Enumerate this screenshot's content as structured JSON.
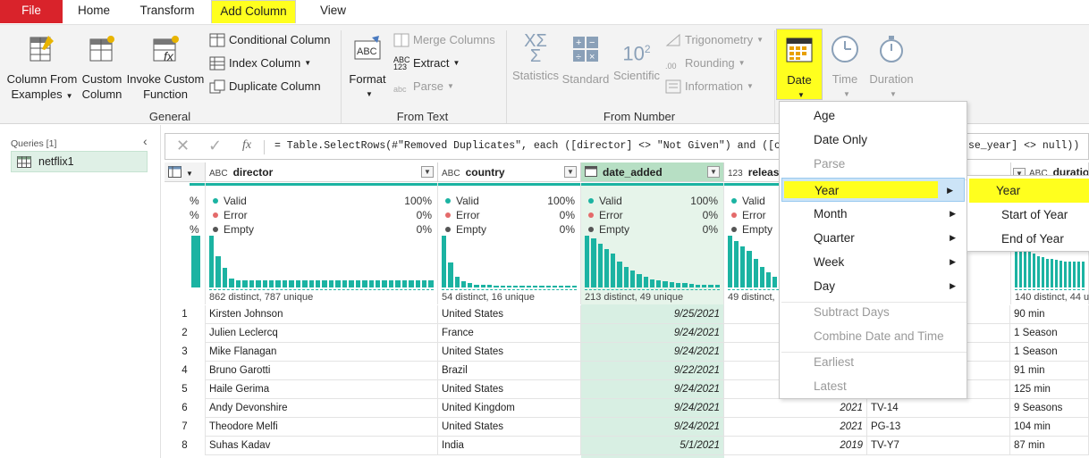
{
  "tabs": [
    "File",
    "Home",
    "Transform",
    "Add Column",
    "View"
  ],
  "ribbon": {
    "general": {
      "label": "General",
      "col_from_examples": [
        "Column From",
        "Examples"
      ],
      "custom_column": [
        "Custom",
        "Column"
      ],
      "invoke_custom_function": [
        "Invoke Custom",
        "Function"
      ],
      "conditional_column": "Conditional Column",
      "index_column": "Index Column",
      "duplicate_column": "Duplicate Column"
    },
    "from_text": {
      "label": "From Text",
      "format": "Format",
      "merge_columns": "Merge Columns",
      "extract": "Extract",
      "parse": "Parse",
      "extract_icon_text": [
        "ABC",
        "123"
      ],
      "parse_icon_text": "abc"
    },
    "from_number": {
      "label": "From Number",
      "statistics": "Statistics",
      "standard": "Standard",
      "scientific": "Scientific",
      "trigonometry": "Trigonometry",
      "rounding": "Rounding",
      "information": "Information",
      "scientific_icon_text": "10",
      "scientific_icon_sup": "2",
      "rounding_icon_text": ".00"
    },
    "datetime": {
      "date": "Date",
      "time": "Time",
      "duration": "Duration"
    }
  },
  "queries": {
    "header": "Queries [1]",
    "items": [
      "netflix1"
    ]
  },
  "formula": {
    "fx": "fx",
    "left": "= Table.SelectRows(#\"Removed Duplicates\", each ([director] <> \"Not Given\") and ([coun",
    "right": "se_year] <> null))"
  },
  "columns": [
    {
      "type": "ABC",
      "name": "director"
    },
    {
      "type": "ABC",
      "name": "country"
    },
    {
      "type": "cal",
      "name": "date_added"
    },
    {
      "type": "123",
      "name": "release"
    },
    {
      "type": "ABC",
      "name": "duration"
    }
  ],
  "profile": {
    "labels": [
      "Valid",
      "Error",
      "Empty"
    ],
    "first_partial": [
      "%",
      "%",
      "%"
    ],
    "director": {
      "vals": [
        "100%",
        "0%",
        "0%"
      ],
      "distinct": "862 distinct, 787 unique"
    },
    "country": {
      "vals": [
        "100%",
        "0%",
        "0%"
      ],
      "distinct": "54 distinct, 16 unique"
    },
    "date_added": {
      "vals": [
        "100%",
        "0%",
        "0%"
      ],
      "distinct": "213 distinct, 49 unique"
    },
    "release": {
      "vals": [
        "Valid",
        "Error",
        "Empty"
      ],
      "distinct": "49 distinct,"
    },
    "duration": {
      "distinct": "140 distinct, 44 u"
    }
  },
  "rows": [
    {
      "n": "1",
      "director": "Kirsten Johnson",
      "country": "United States",
      "date": "9/25/2021",
      "year": "",
      "rating": "",
      "duration": "90 min"
    },
    {
      "n": "2",
      "director": "Julien Leclercq",
      "country": "France",
      "date": "9/24/2021",
      "year": "",
      "rating": "",
      "duration": "1 Season"
    },
    {
      "n": "3",
      "director": "Mike Flanagan",
      "country": "United States",
      "date": "9/24/2021",
      "year": "",
      "rating": "",
      "duration": "1 Season"
    },
    {
      "n": "4",
      "director": "Bruno Garotti",
      "country": "Brazil",
      "date": "9/22/2021",
      "year": "",
      "rating": "",
      "duration": "91 min"
    },
    {
      "n": "5",
      "director": "Haile Gerima",
      "country": "United States",
      "date": "9/24/2021",
      "year": "",
      "rating": "",
      "duration": "125 min"
    },
    {
      "n": "6",
      "director": "Andy Devonshire",
      "country": "United Kingdom",
      "date": "9/24/2021",
      "year": "2021",
      "rating": "TV-14",
      "duration": "9 Seasons"
    },
    {
      "n": "7",
      "director": "Theodore Melfi",
      "country": "United States",
      "date": "9/24/2021",
      "year": "2021",
      "rating": "PG-13",
      "duration": "104 min"
    },
    {
      "n": "8",
      "director": "Suhas Kadav",
      "country": "India",
      "date": "5/1/2021",
      "year": "2019",
      "rating": "TV-Y7",
      "duration": "87 min"
    }
  ],
  "date_menu": {
    "items": [
      "Age",
      "Date Only",
      "Parse",
      "Year",
      "Month",
      "Quarter",
      "Week",
      "Day",
      "Subtract Days",
      "Combine Date and Time",
      "Earliest",
      "Latest"
    ]
  },
  "year_submenu": {
    "items": [
      "Year",
      "Start of Year",
      "End of Year"
    ]
  },
  "colors": {
    "accent": "#1bb3a2",
    "highlight": "#ffff1e",
    "file_tab": "#d9232b",
    "selected_col": "#d8efe3"
  }
}
